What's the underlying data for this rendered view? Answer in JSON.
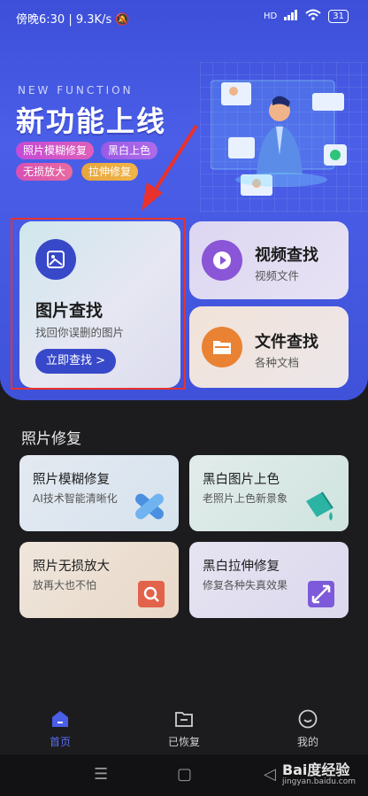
{
  "status": {
    "time": "傍晚6:30",
    "speed": "9.3K/s",
    "network": "HD",
    "battery": "31"
  },
  "hero": {
    "subtitle": "NEW FUNCTION",
    "title": "新功能上线",
    "tags": [
      "照片模糊修复",
      "黑白上色",
      "无损放大",
      "拉伸修复"
    ]
  },
  "photo_find": {
    "title": "图片查找",
    "subtitle": "找回你误删的图片",
    "button": "立即查找 >"
  },
  "video_find": {
    "title": "视频查找",
    "subtitle": "视频文件"
  },
  "file_find": {
    "title": "文件查找",
    "subtitle": "各种文档"
  },
  "repair": {
    "section_title": "照片修复",
    "items": [
      {
        "title": "照片模糊修复",
        "subtitle": "AI技术智能清晰化"
      },
      {
        "title": "黑白图片上色",
        "subtitle": "老照片上色新景象"
      },
      {
        "title": "照片无损放大",
        "subtitle": "放再大也不怕"
      },
      {
        "title": "黑白拉伸修复",
        "subtitle": "修复各种失真效果"
      }
    ]
  },
  "nav": {
    "items": [
      {
        "label": "首页",
        "icon": "home-icon"
      },
      {
        "label": "已恢复",
        "icon": "folder-icon"
      },
      {
        "label": "我的",
        "icon": "smile-icon"
      }
    ]
  },
  "watermark": {
    "brand": "Bai度经验",
    "url": "jingyan.baidu.com"
  },
  "colors": {
    "accent": "#3748c9",
    "hero": "#4357e0",
    "highlight": "#e8322e"
  }
}
